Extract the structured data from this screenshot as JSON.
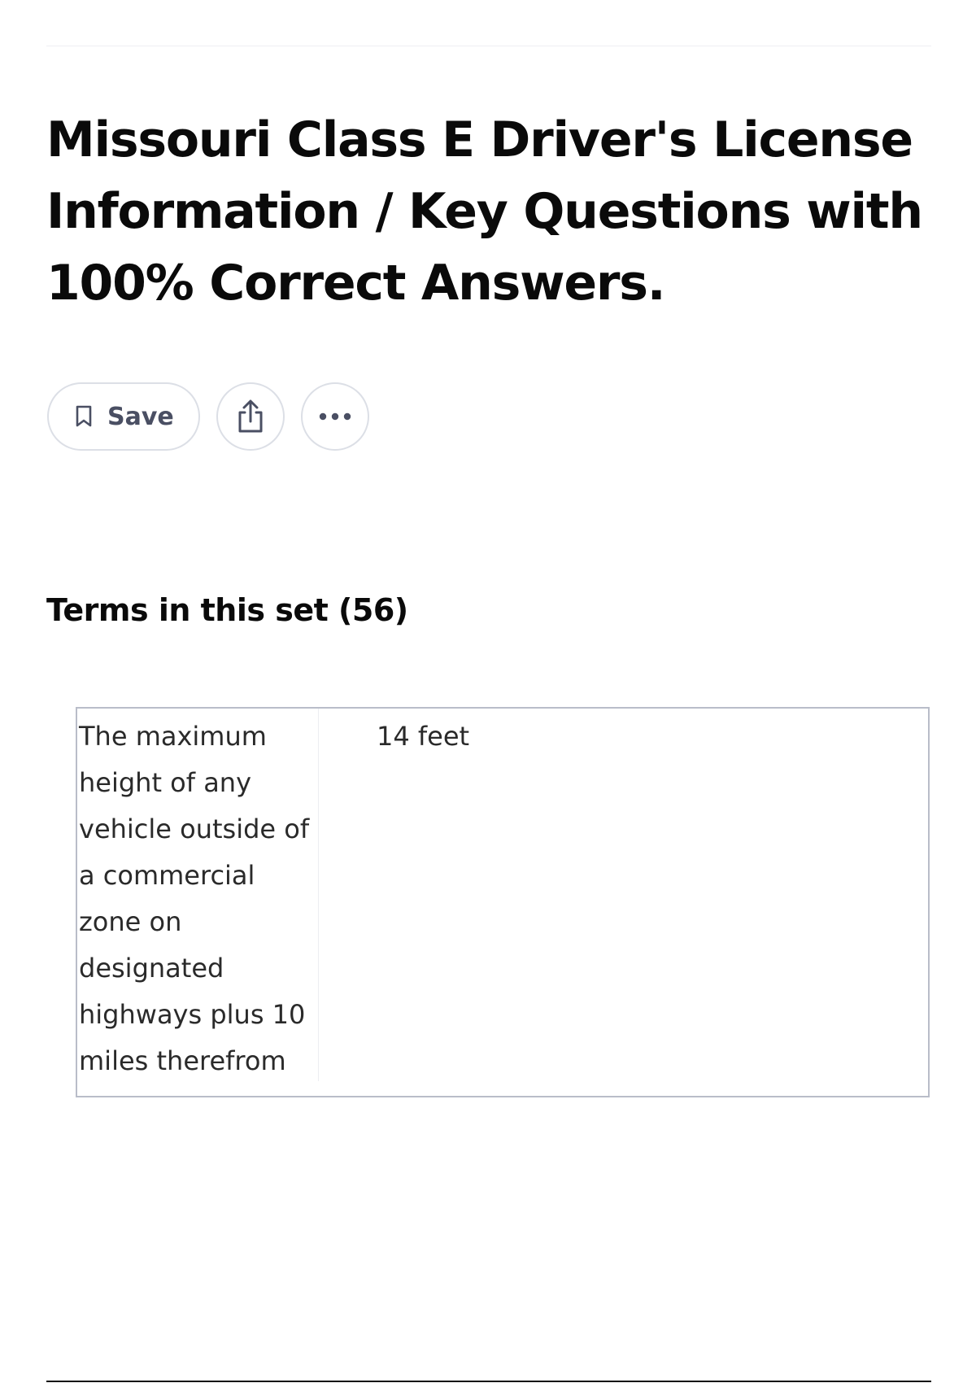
{
  "title": "Missouri Class E Driver's License Information / Key Questions with 100% Correct Answers.",
  "actions": {
    "save_label": "Save",
    "save_icon": "bookmark-icon",
    "share_icon": "share-icon",
    "more_icon": "more-horizontal-icon"
  },
  "terms_section": {
    "heading": "Terms in this set (56)",
    "items": [
      {
        "term": "The maximum height of any vehicle outside of a commercial zone on designated highways plus 10 miles therefrom",
        "definition": "14 feet"
      }
    ]
  },
  "colors": {
    "title_text": "#0a0a0a",
    "button_border": "#dcdfe6",
    "button_label": "#4a4f63",
    "card_border": "#b9bdc9"
  }
}
